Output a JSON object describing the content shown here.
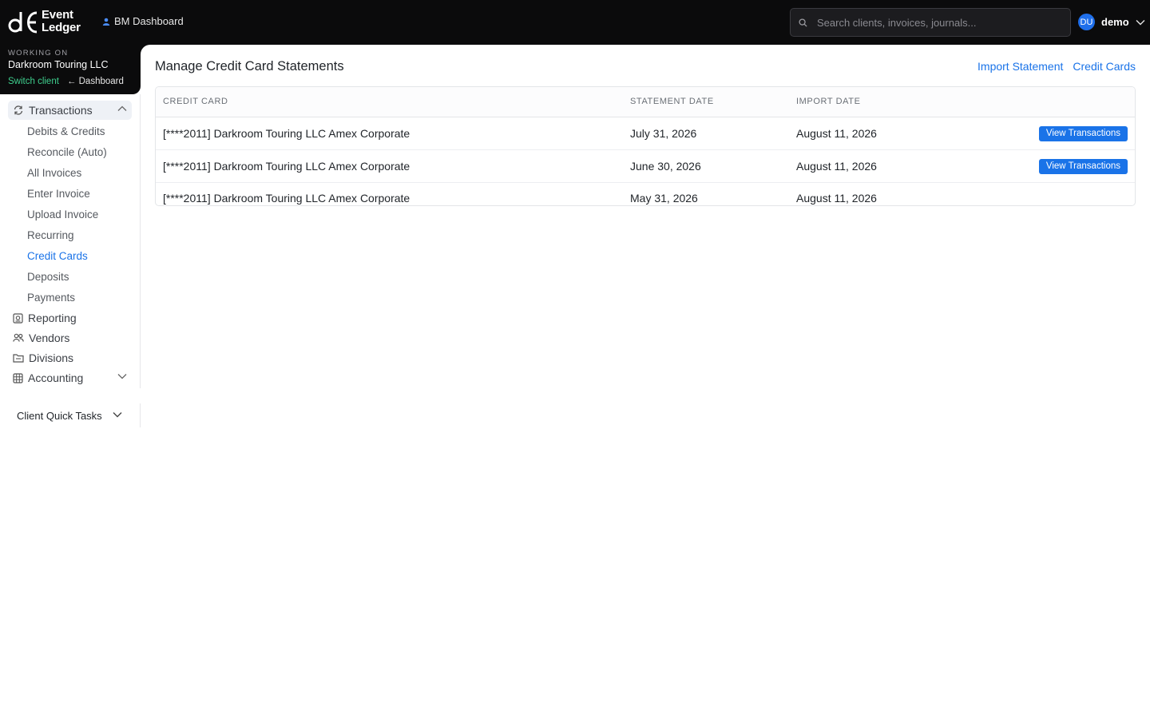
{
  "brand": {
    "line1": "Event",
    "line2": "Ledger"
  },
  "topbar": {
    "bm_dashboard_label": "BM Dashboard",
    "search_placeholder": "Search clients, invoices, journals...",
    "avatar_initials": "DU",
    "username": "demo"
  },
  "working_on": {
    "kicker": "WORKING ON",
    "client_name": "Darkroom Touring LLC",
    "switch_label": "Switch client",
    "dashboard_label": "Dashboard"
  },
  "sidebar": {
    "transactions_label": "Transactions",
    "transactions_items": [
      "Debits & Credits",
      "Reconcile (Auto)",
      "All Invoices",
      "Enter Invoice",
      "Upload Invoice",
      "Recurring",
      "Credit Cards",
      "Deposits",
      "Payments"
    ],
    "current_item": "Credit Cards",
    "reporting_label": "Reporting",
    "vendors_label": "Vendors",
    "divisions_label": "Divisions",
    "accounting_label": "Accounting",
    "quick_tasks_label": "Client Quick Tasks"
  },
  "main": {
    "title": "Manage Credit Card Statements",
    "import_statement_label": "Import Statement",
    "credit_cards_label": "Credit Cards",
    "columns": [
      "CREDIT CARD",
      "STATEMENT DATE",
      "IMPORT DATE"
    ],
    "view_button_label": "View Transactions",
    "rows": [
      {
        "card": "[****2011] Darkroom Touring LLC Amex Corporate",
        "statement_date": "July 31, 2026",
        "import_date": "August 11, 2026"
      },
      {
        "card": "[****2011] Darkroom Touring LLC Amex Corporate",
        "statement_date": "June 30, 2026",
        "import_date": "August 11, 2026"
      },
      {
        "card": "[****2011] Darkroom Touring LLC Amex Corporate",
        "statement_date": "May 31, 2026",
        "import_date": "August 11, 2026"
      }
    ]
  },
  "colors": {
    "accent": "#1a73e8",
    "topbar_bg": "#0b0b0c",
    "switch_green": "#3ecf8e"
  }
}
